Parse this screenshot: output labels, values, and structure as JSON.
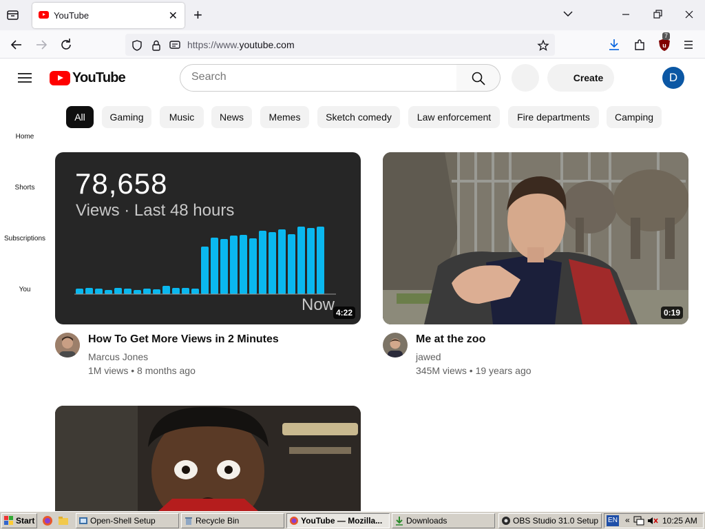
{
  "browser": {
    "tab_title": "YouTube",
    "tab_close": "✕",
    "new_tab": "+",
    "url_prefix": "https://www.",
    "url_domain": "youtube.com",
    "extension_badge": "7"
  },
  "header": {
    "logo_text": "YouTube",
    "search_placeholder": "Search",
    "create_label": "Create",
    "avatar_letter": "D"
  },
  "chips": [
    "All",
    "Gaming",
    "Music",
    "News",
    "Memes",
    "Sketch comedy",
    "Law enforcement",
    "Fire departments",
    "Camping"
  ],
  "rail": [
    "Home",
    "Shorts",
    "Subscriptions",
    "You"
  ],
  "videos": [
    {
      "thumb_big_number": "78,658",
      "thumb_subtitle": "Views · Last 48 hours",
      "thumb_now": "Now",
      "bar_levels": [
        0.08,
        0.09,
        0.08,
        0.06,
        0.09,
        0.08,
        0.06,
        0.08,
        0.07,
        0.12,
        0.09,
        0.09,
        0.08,
        0.69,
        0.82,
        0.8,
        0.85,
        0.86,
        0.81,
        0.92,
        0.9,
        0.94,
        0.87,
        0.98,
        0.96,
        0.98
      ],
      "duration": "4:22",
      "title": "How To Get More Views in 2 Minutes",
      "channel": "Marcus Jones",
      "meta": "1M views • 8 months ago"
    },
    {
      "duration": "0:19",
      "title": "Me at the zoo",
      "channel": "jawed",
      "meta": "345M views • 19 years ago"
    }
  ],
  "taskbar": {
    "start": "Start",
    "items": [
      "Open-Shell Setup",
      "Recycle Bin",
      "YouTube — Mozilla...",
      "Downloads",
      "OBS Studio 31.0 Setup"
    ],
    "lang": "EN",
    "clock": "10:25 AM"
  },
  "colors": {
    "youtube_red": "#ff0000",
    "chart_bar": "#0ab8ef",
    "avatar_blue": "#0b57a4"
  }
}
